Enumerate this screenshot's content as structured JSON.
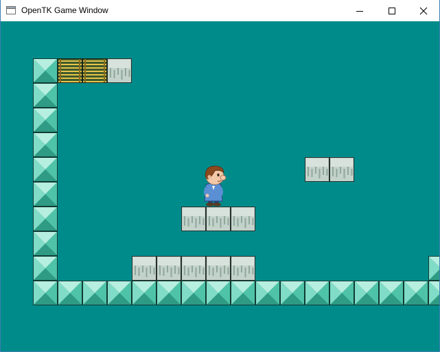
{
  "window": {
    "title": "OpenTK Game Window",
    "icon": "window-app-icon",
    "controls": [
      "minimize-icon",
      "maximize-icon",
      "close-icon"
    ]
  },
  "game": {
    "background_color": "#008b8b",
    "tile_types": {
      "gem": "teal pyramid stud block",
      "stone": "grey-green stone block",
      "ladder": "yellow ladder/bridge block"
    },
    "tiles": [
      {
        "type": "gem",
        "col": 1,
        "row": 1
      },
      {
        "type": "ladder",
        "col": 2,
        "row": 1
      },
      {
        "type": "ladder",
        "col": 3,
        "row": 1
      },
      {
        "type": "stone",
        "col": 4,
        "row": 1
      },
      {
        "type": "gem",
        "col": 1,
        "row": 2
      },
      {
        "type": "gem",
        "col": 1,
        "row": 3
      },
      {
        "type": "gem",
        "col": 1,
        "row": 4
      },
      {
        "type": "gem",
        "col": 1,
        "row": 5
      },
      {
        "type": "stone",
        "col": 12,
        "row": 5
      },
      {
        "type": "stone",
        "col": 13,
        "row": 5
      },
      {
        "type": "gem",
        "col": 1,
        "row": 6
      },
      {
        "type": "gem",
        "col": 1,
        "row": 7
      },
      {
        "type": "stone",
        "col": 7,
        "row": 7
      },
      {
        "type": "stone",
        "col": 8,
        "row": 7
      },
      {
        "type": "stone",
        "col": 9,
        "row": 7
      },
      {
        "type": "gem",
        "col": 1,
        "row": 8
      },
      {
        "type": "gem",
        "col": 1,
        "row": 9
      },
      {
        "type": "stone",
        "col": 5,
        "row": 9
      },
      {
        "type": "stone",
        "col": 6,
        "row": 9
      },
      {
        "type": "stone",
        "col": 7,
        "row": 9
      },
      {
        "type": "stone",
        "col": 8,
        "row": 9
      },
      {
        "type": "stone",
        "col": 9,
        "row": 9
      },
      {
        "type": "gem",
        "col": 17,
        "row": 9
      },
      {
        "type": "gem",
        "col": 1,
        "row": 10
      },
      {
        "type": "gem",
        "col": 2,
        "row": 10
      },
      {
        "type": "gem",
        "col": 3,
        "row": 10
      },
      {
        "type": "gem",
        "col": 4,
        "row": 10
      },
      {
        "type": "gem",
        "col": 5,
        "row": 10
      },
      {
        "type": "gem",
        "col": 6,
        "row": 10
      },
      {
        "type": "gem",
        "col": 7,
        "row": 10
      },
      {
        "type": "gem",
        "col": 8,
        "row": 10
      },
      {
        "type": "gem",
        "col": 9,
        "row": 10
      },
      {
        "type": "gem",
        "col": 10,
        "row": 10
      },
      {
        "type": "gem",
        "col": 11,
        "row": 10
      },
      {
        "type": "gem",
        "col": 12,
        "row": 10
      },
      {
        "type": "gem",
        "col": 13,
        "row": 10
      },
      {
        "type": "gem",
        "col": 14,
        "row": 10
      },
      {
        "type": "gem",
        "col": 15,
        "row": 10
      },
      {
        "type": "gem",
        "col": 16,
        "row": 10
      },
      {
        "type": "gem",
        "col": 17,
        "row": 10
      }
    ],
    "player": {
      "sprite": "boy-character",
      "col": 8,
      "row": 6
    }
  }
}
